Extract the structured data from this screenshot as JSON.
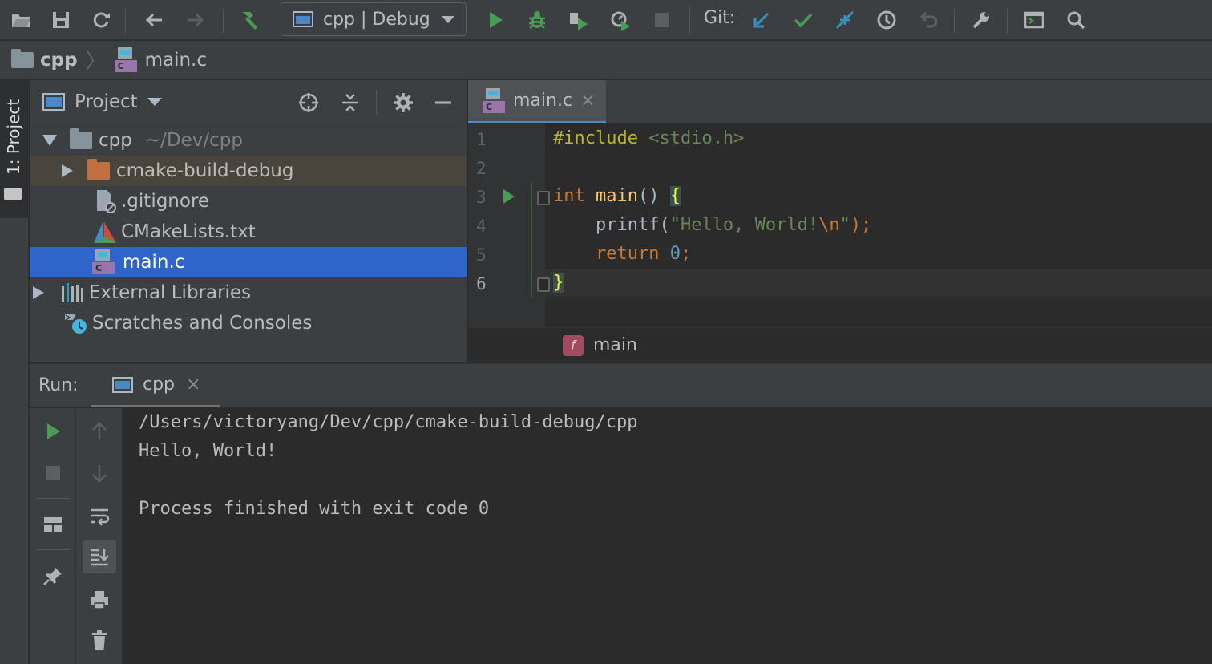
{
  "colors": {
    "bg_editor": "#2b2b2b",
    "bg_panel": "#3c3f41",
    "selection": "#2f65ca",
    "keyword": "#cc7832",
    "string": "#6a8759",
    "number": "#6897bb",
    "function": "#ffc66d",
    "preprocessor": "#bbb529",
    "run_green": "#499c54",
    "git_blue": "#3592c4"
  },
  "toolbar": {
    "run_config": "cpp | Debug",
    "git_label": "Git:",
    "icons": [
      "open-icon",
      "save-icon",
      "sync-icon",
      "back-icon",
      "forward-icon",
      "build-hammer-icon",
      "run-icon",
      "debug-icon",
      "run-with-coverage-icon",
      "profile-icon",
      "stop-icon",
      "git-update-icon",
      "git-commit-icon",
      "git-merge-icon",
      "git-history-icon",
      "git-revert-icon",
      "settings-wrench-icon",
      "terminal-icon",
      "search-icon"
    ]
  },
  "breadcrumb": {
    "project": "cpp",
    "file": "main.c",
    "file_badge": "C"
  },
  "left_stripe": {
    "tab_label": "1: Project"
  },
  "project_panel": {
    "title": "Project",
    "tree": [
      {
        "label": "cpp",
        "hint": "~/Dev/cpp"
      },
      {
        "label": "cmake-build-debug"
      },
      {
        "label": ".gitignore"
      },
      {
        "label": "CMakeLists.txt"
      },
      {
        "label": "main.c",
        "badge": "C",
        "selected": true
      },
      {
        "label": "External Libraries"
      },
      {
        "label": "Scratches and Consoles"
      }
    ]
  },
  "editor": {
    "tab_label": "main.c",
    "tab_badge": "C",
    "close_glyph": "×",
    "line_numbers": [
      "1",
      "2",
      "3",
      "4",
      "5",
      "6"
    ],
    "code": {
      "l1_directive": "#include",
      "l1_header": "<stdio.h>",
      "l3_type": "int",
      "l3_name": "main",
      "l3_parens": "()",
      "l3_brace": "{",
      "l4_call": "printf(",
      "l4_string_a": "\"Hello, World!",
      "l4_escape": "\\n",
      "l4_string_b": "\"",
      "l4_end": ");",
      "l5_keyword": "return",
      "l5_value": "0",
      "l5_end": ";",
      "l6_brace": "}"
    },
    "structure": {
      "badge": "f",
      "name": "main"
    }
  },
  "run_panel": {
    "label": "Run:",
    "tab_label": "cpp",
    "close_glyph": "×",
    "output": [
      "/Users/victoryang/Dev/cpp/cmake-build-debug/cpp",
      "Hello, World!",
      "",
      "Process finished with exit code 0"
    ]
  }
}
